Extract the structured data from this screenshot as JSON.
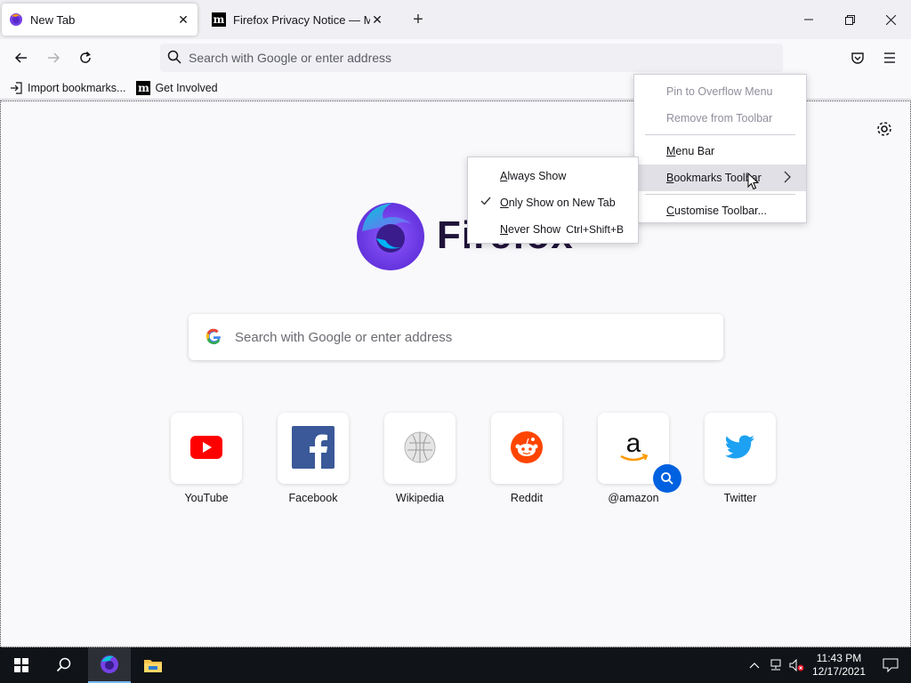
{
  "tabs": [
    {
      "title": "New Tab",
      "active": true,
      "favicon": "firefox-icon"
    },
    {
      "title": "Firefox Privacy Notice — Mozilla",
      "active": false,
      "favicon": "mozilla-m-icon"
    }
  ],
  "window_controls": {
    "minimize": "—",
    "restore": "❐",
    "close": "✕"
  },
  "navbar": {
    "url_placeholder": "Search with Google or enter address"
  },
  "bookmarks": [
    {
      "label": "Import bookmarks...",
      "icon": "import-icon"
    },
    {
      "label": "Get Involved",
      "icon": "mozilla-m-icon"
    }
  ],
  "newtab": {
    "wordmark": "Firefox",
    "search_placeholder": "Search with Google or enter address",
    "top_sites": [
      {
        "label": "YouTube",
        "icon": "youtube-icon"
      },
      {
        "label": "Facebook",
        "icon": "facebook-icon"
      },
      {
        "label": "Wikipedia",
        "icon": "wikipedia-icon"
      },
      {
        "label": "Reddit",
        "icon": "reddit-icon"
      },
      {
        "label": "@amazon",
        "icon": "amazon-icon"
      },
      {
        "label": "Twitter",
        "icon": "twitter-icon"
      }
    ]
  },
  "context_menu": {
    "items": [
      {
        "label": "Pin to Overflow Menu",
        "disabled": true
      },
      {
        "label": "Remove from Toolbar",
        "disabled": true
      },
      {
        "label": "Menu Bar",
        "accesskey": "M"
      },
      {
        "label": "Bookmarks Toolbar",
        "accesskey": "B"
      },
      {
        "label": "Customise Toolbar...",
        "accesskey": "C"
      }
    ]
  },
  "submenu": {
    "items": [
      {
        "label": "Always Show",
        "accesskey": "A"
      },
      {
        "label": "Only Show on New Tab",
        "accesskey": "O",
        "checked": true
      },
      {
        "label": "Never Show",
        "accesskey": "N",
        "shortcut": "Ctrl+Shift+B"
      }
    ]
  },
  "taskbar": {
    "time": "11:43 PM",
    "date": "12/17/2021"
  },
  "colors": {
    "accent": "#0061e0",
    "youtube": "#ff0000",
    "facebook": "#3b5998",
    "reddit": "#ff4500",
    "twitter": "#1da1f2"
  }
}
